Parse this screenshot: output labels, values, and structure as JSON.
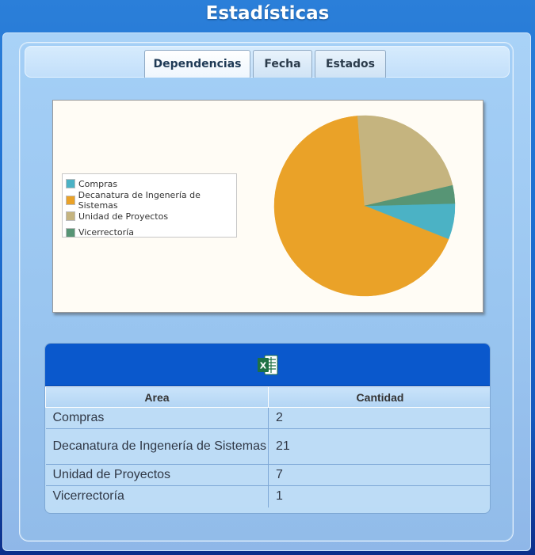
{
  "page": {
    "title": "Estadísticas"
  },
  "tabs": [
    {
      "label": "Dependencias",
      "active": true
    },
    {
      "label": "Fecha",
      "active": false
    },
    {
      "label": "Estados",
      "active": false
    }
  ],
  "chart_data": {
    "type": "pie",
    "categories": [
      "Compras",
      "Decanatura de Ingenería de Sistemas",
      "Unidad de Proyectos",
      "Vicerrectoría"
    ],
    "values": [
      2,
      21,
      7,
      1
    ],
    "colors": [
      "#4bb2c5",
      "#eaa228",
      "#c5b47f",
      "#579575"
    ],
    "legend_placement": "left"
  },
  "grid": {
    "export_icon": "excel-icon",
    "columns": [
      "Area",
      "Cantidad"
    ],
    "rows": [
      {
        "area": "Compras",
        "cantidad": "2"
      },
      {
        "area": "Decanatura de Ingenería de Sistemas",
        "cantidad": "21"
      },
      {
        "area": "Unidad de Proyectos",
        "cantidad": "7"
      },
      {
        "area": "Vicerrectoría",
        "cantidad": "1"
      }
    ]
  }
}
